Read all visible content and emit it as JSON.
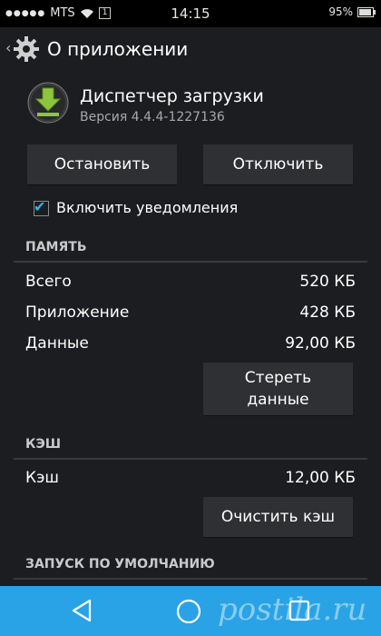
{
  "status_bar": {
    "carrier": "MTS",
    "sim": "1",
    "time": "14:15",
    "battery_text": "95%",
    "battery_level": 0.95
  },
  "action_bar": {
    "title": "О приложении",
    "icon": "settings-gear-icon"
  },
  "app": {
    "name": "Диспетчер загрузки",
    "version": "Версия 4.4.4-1227136",
    "icon": "download-icon"
  },
  "buttons": {
    "force_stop": "Остановить",
    "disable": "Отключить",
    "clear_data_line1": "Стереть",
    "clear_data_line2": "данные",
    "clear_cache": "Очистить кэш"
  },
  "notifications": {
    "label": "Включить уведомления",
    "checked": true
  },
  "storage": {
    "header": "ПАМЯТЬ",
    "rows": [
      {
        "label": "Всего",
        "value": "520 КБ"
      },
      {
        "label": "Приложение",
        "value": "428 КБ"
      },
      {
        "label": "Данные",
        "value": "92,00 КБ"
      }
    ]
  },
  "cache": {
    "header": "КЭШ",
    "label": "Кэш",
    "value": "12,00 КБ"
  },
  "launch_default": {
    "header": "ЗАПУСК ПО УМОЛЧАНИЮ"
  },
  "nav_bar": {
    "watermark": "postila.ru"
  },
  "colors": {
    "accent": "#33b5e5",
    "background": "#1c1d20",
    "button": "#2f3033",
    "nav_bar": "#29a3e6"
  }
}
